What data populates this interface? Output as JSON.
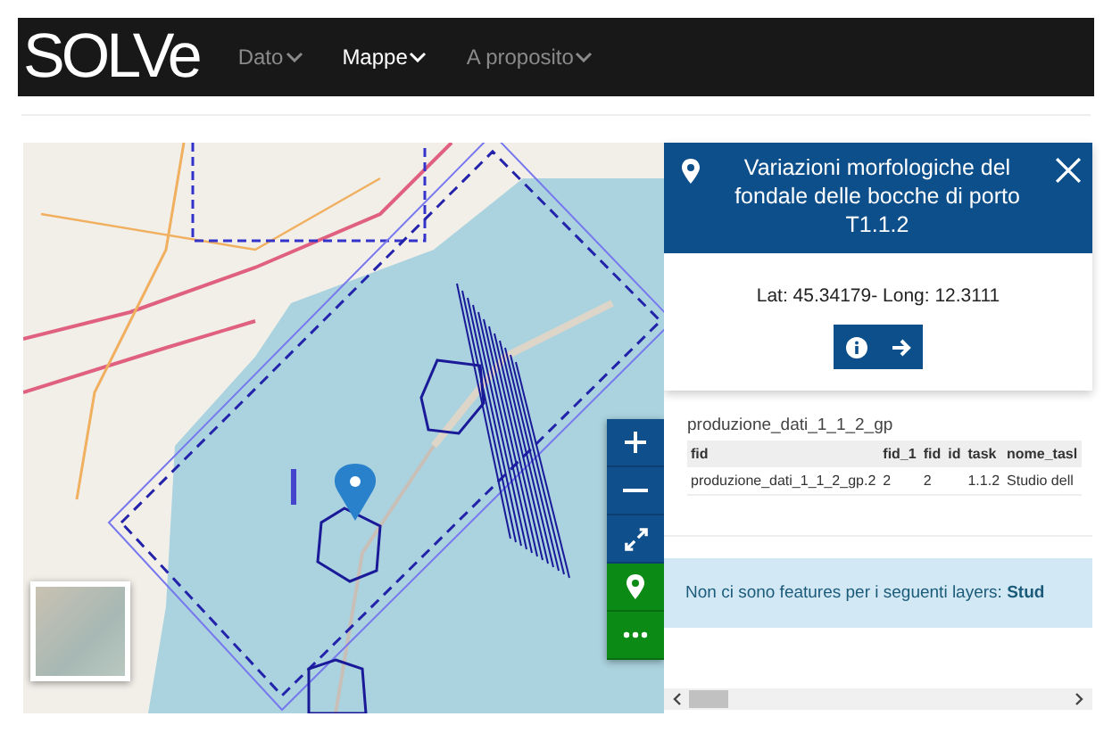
{
  "navbar": {
    "logo": "SOLVe",
    "menu": [
      {
        "label": "Dato",
        "selected": false
      },
      {
        "label": "Mappe",
        "selected": true
      },
      {
        "label": "A proposito",
        "selected": false
      }
    ]
  },
  "map": {
    "controls": [
      {
        "kind": "zoom_in"
      },
      {
        "kind": "zoom_out"
      },
      {
        "kind": "fullscreen"
      },
      {
        "kind": "locate"
      },
      {
        "kind": "more"
      }
    ]
  },
  "popup": {
    "title": "Variazioni morfologiche del fondale delle bocche di porto T1.1.2",
    "coordinates": "Lat: 45.34179- Long: 12.3111"
  },
  "table": {
    "title": "produzione_dati_1_1_2_gp",
    "columns": [
      "fid",
      "fid_1",
      "fid",
      "id",
      "task",
      "nome_tasl"
    ],
    "rows": [
      [
        "produzione_dati_1_1_2_gp.2",
        "2",
        "2",
        "",
        "1.1.2",
        "Studio dell"
      ]
    ]
  },
  "alert": "Non ci sono features per i seguenti layers: **Stud**"
}
